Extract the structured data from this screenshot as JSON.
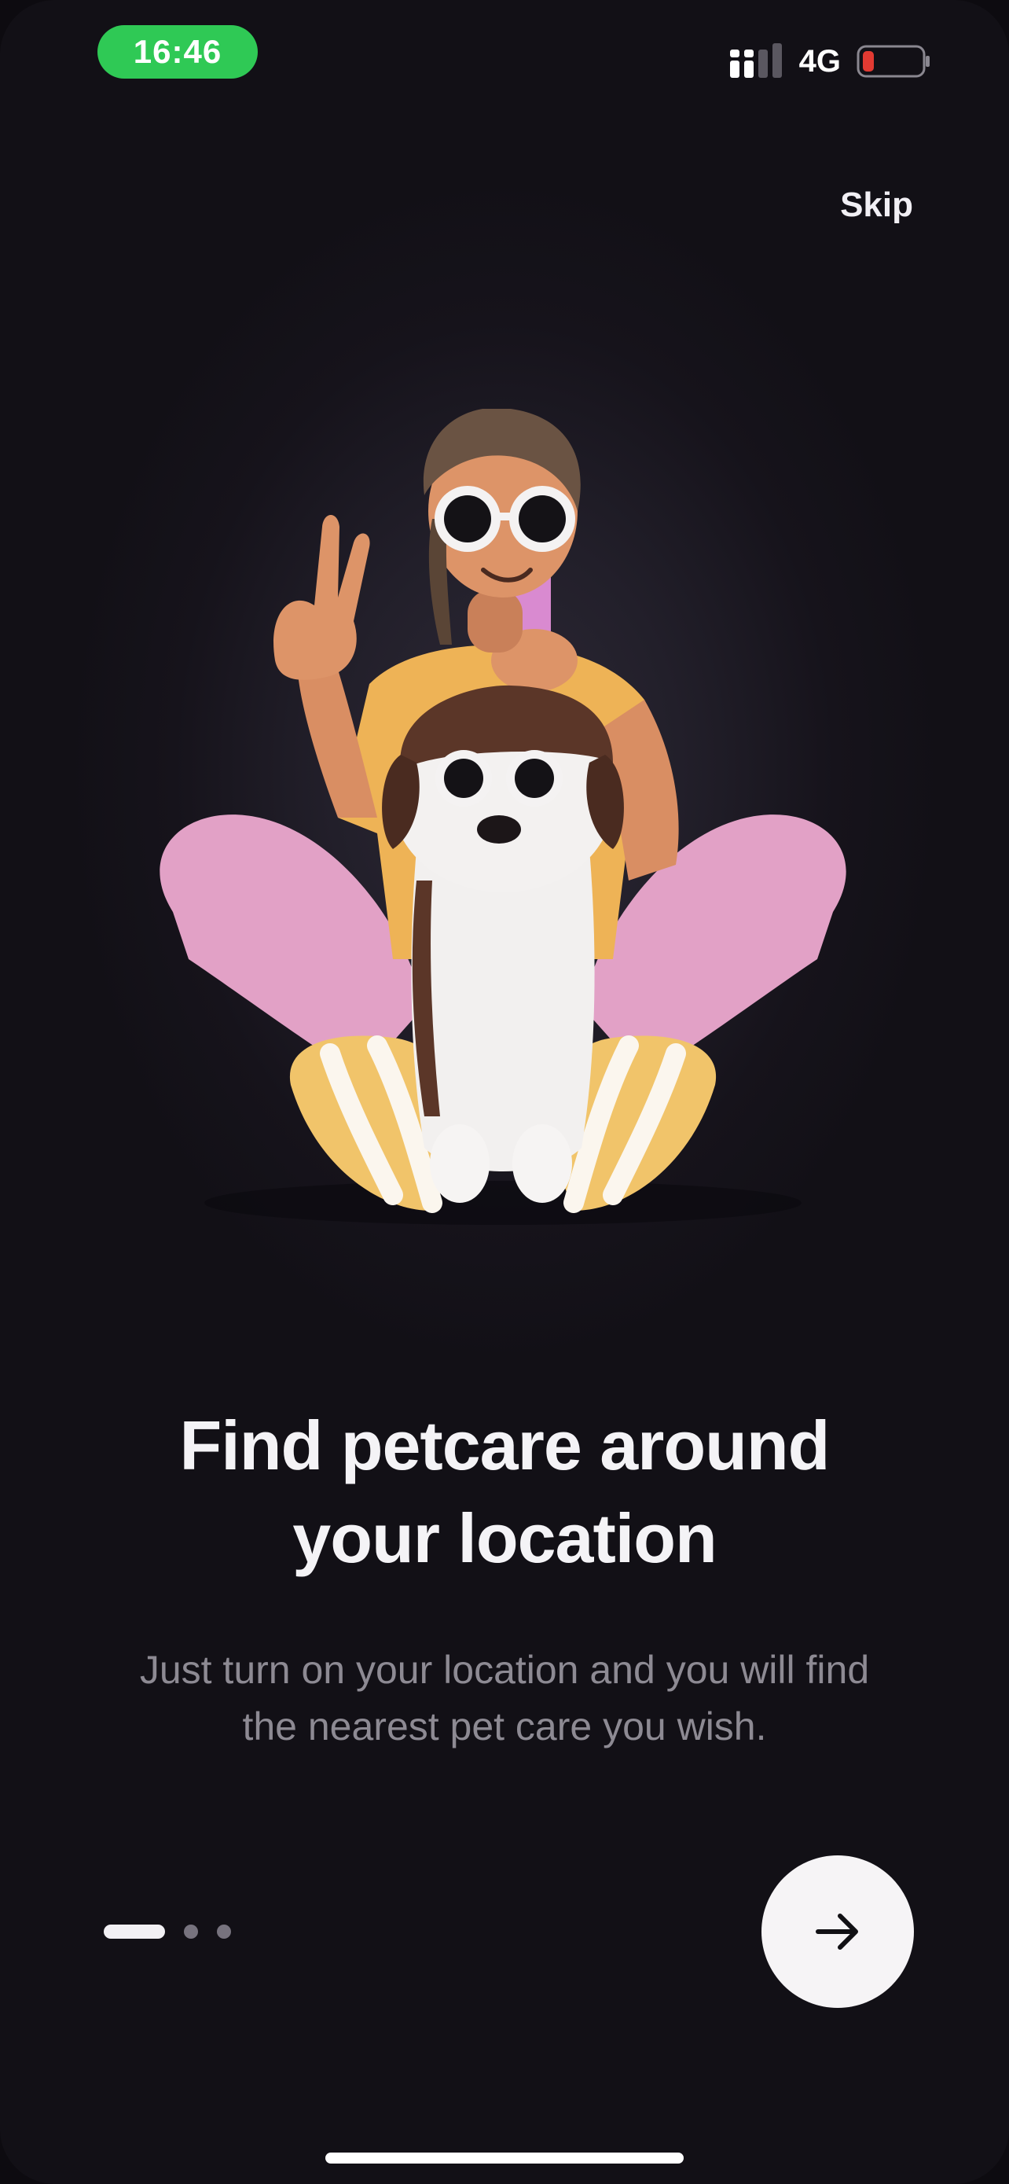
{
  "status_bar": {
    "time": "16:46",
    "network": "4G",
    "battery_level": 0.12,
    "colors": {
      "time_pill": "#2fc955",
      "battery_low": "#e23a32"
    }
  },
  "header": {
    "skip_label": "Skip"
  },
  "illustration": {
    "description_icon": "person-with-dog-illustration"
  },
  "onboarding": {
    "title_line1": "Find petcare around",
    "title_line2": "your location",
    "subtitle_line1": "Just turn on your location and you will find",
    "subtitle_line2": "the nearest pet care you wish."
  },
  "pager": {
    "current_page": 1,
    "total_pages": 3
  },
  "next_button": {
    "icon": "arrow-right-icon"
  }
}
